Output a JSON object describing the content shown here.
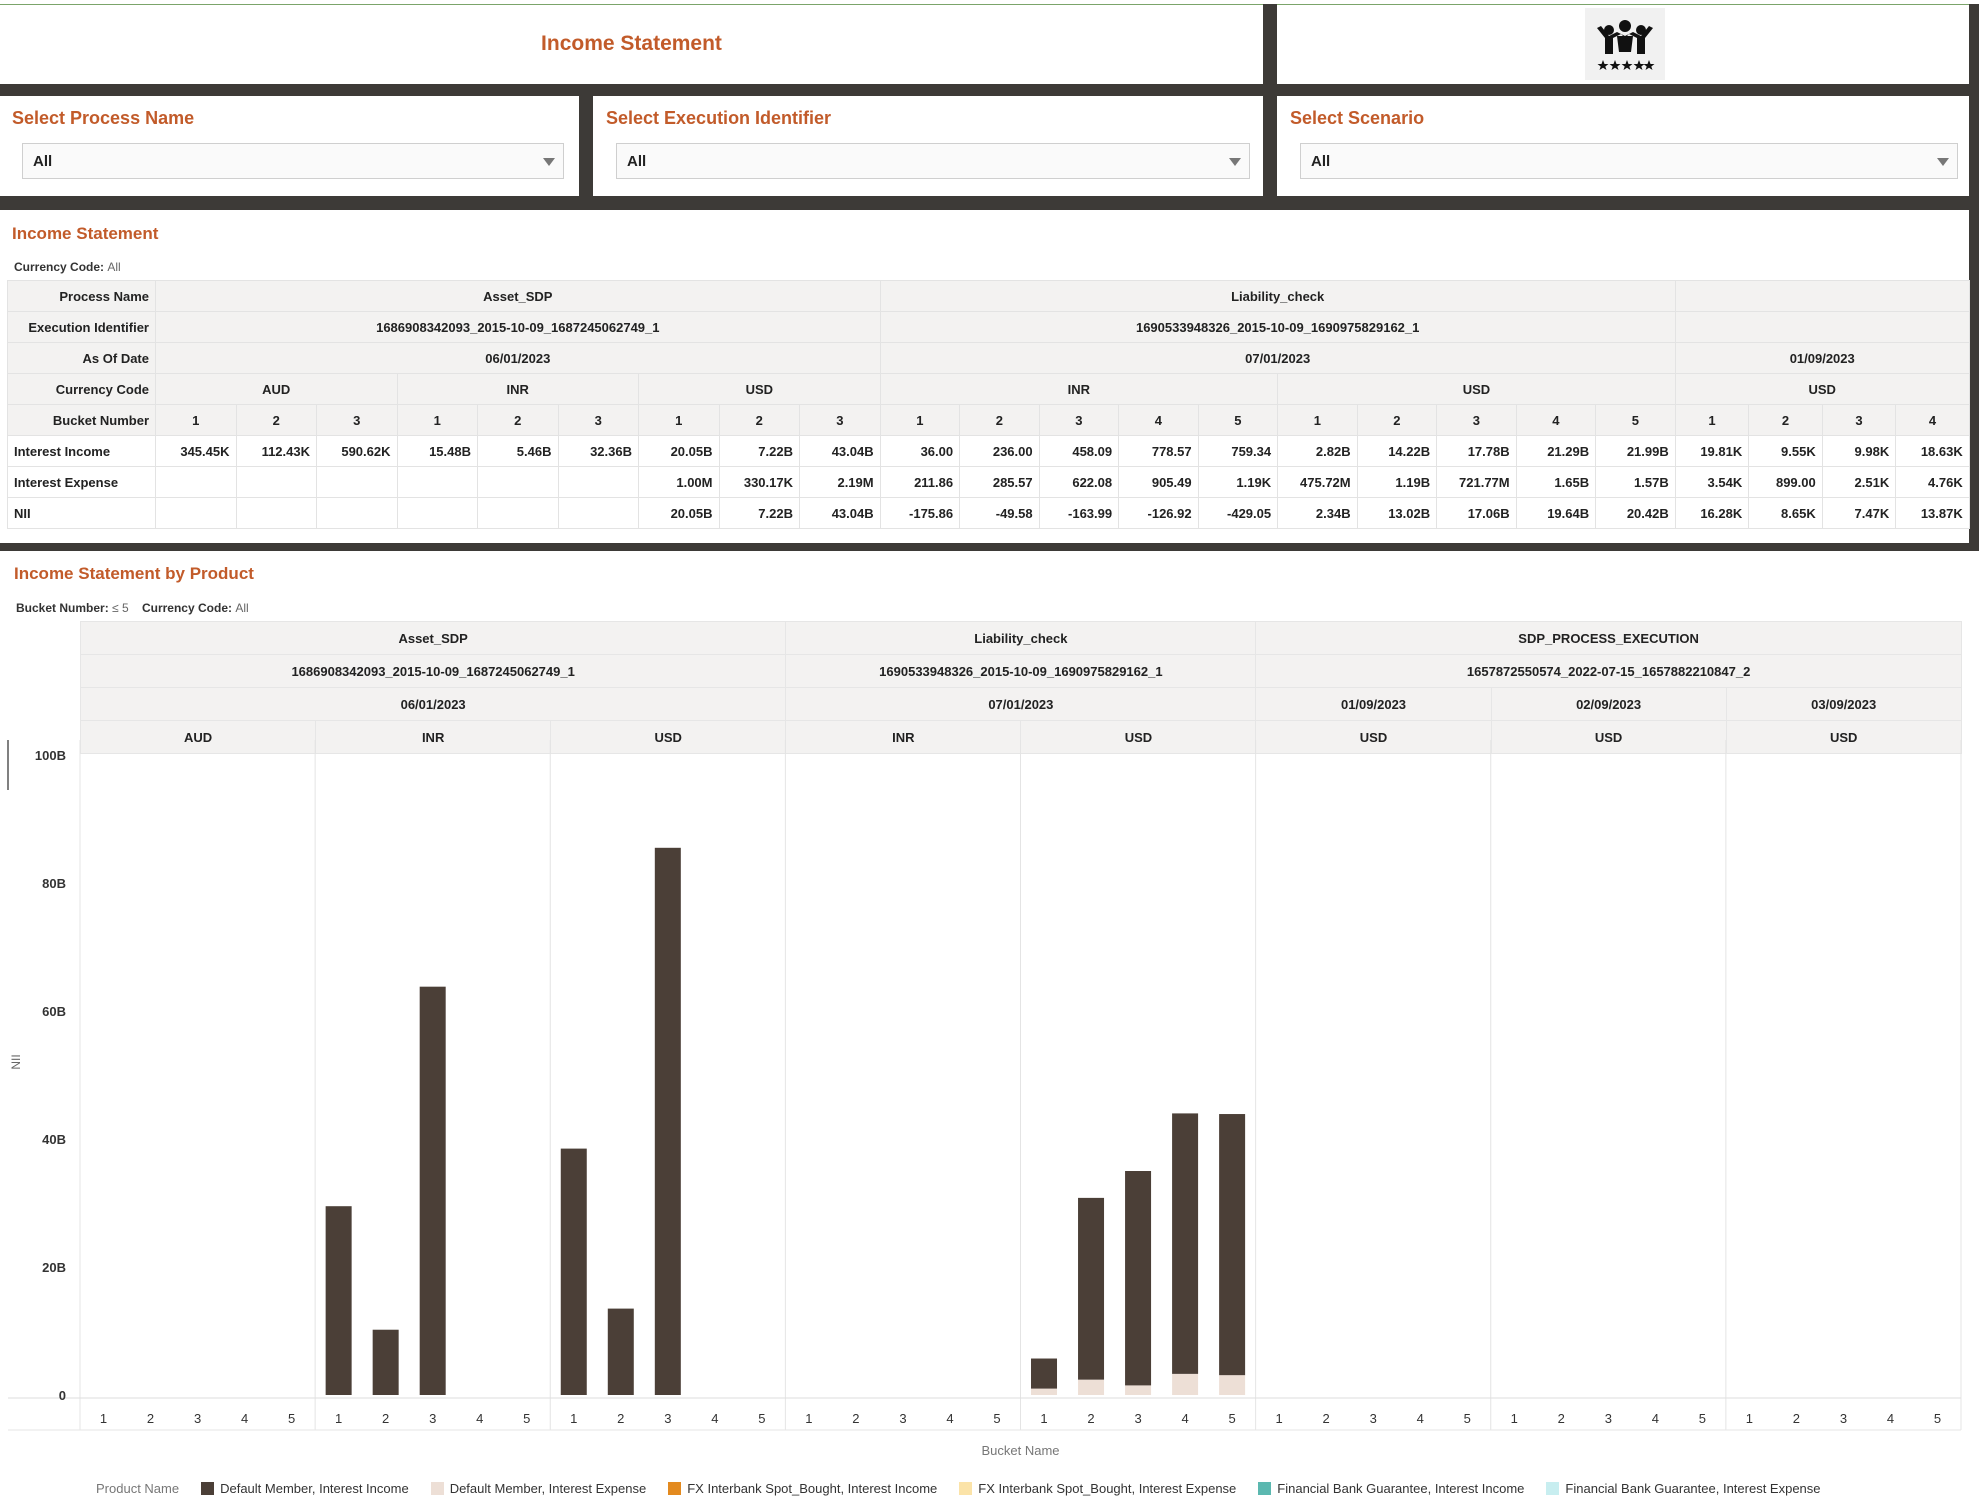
{
  "header": {
    "title": "Income Statement",
    "logo_icon": "people-stars-icon"
  },
  "filters": [
    {
      "label": "Select Process Name",
      "value": "All"
    },
    {
      "label": "Select Execution Identifier",
      "value": "All"
    },
    {
      "label": "Select Scenario",
      "value": "All"
    }
  ],
  "income_statement": {
    "title": "Income Statement",
    "currency_label": "Currency Code:",
    "currency_value": "All",
    "row_labels": {
      "process": "Process Name",
      "execution": "Execution Identifier",
      "as_of": "As Of Date",
      "currency": "Currency Code",
      "bucket": "Bucket Number",
      "income": "Interest Income",
      "expense": "Interest Expense",
      "nii": "NII"
    },
    "processes": [
      "Asset_SDP",
      "Liability_check",
      ""
    ],
    "executions": [
      "1686908342093_2015-10-09_1687245062749_1",
      "1690533948326_2015-10-09_1690975829162_1",
      ""
    ],
    "dates": [
      "06/01/2023",
      "07/01/2023",
      "01/09/2023"
    ],
    "currencies": [
      "AUD",
      "INR",
      "USD",
      "INR",
      "USD",
      "USD"
    ],
    "buckets": [
      "1",
      "2",
      "3",
      "1",
      "2",
      "3",
      "1",
      "2",
      "3",
      "1",
      "2",
      "3",
      "4",
      "5",
      "1",
      "2",
      "3",
      "4",
      "5",
      "1",
      "2",
      "3",
      "4"
    ],
    "interest_income": [
      "345.45K",
      "112.43K",
      "590.62K",
      "15.48B",
      "5.46B",
      "32.36B",
      "20.05B",
      "7.22B",
      "43.04B",
      "36.00",
      "236.00",
      "458.09",
      "778.57",
      "759.34",
      "2.82B",
      "14.22B",
      "17.78B",
      "21.29B",
      "21.99B",
      "19.81K",
      "9.55K",
      "9.98K",
      "18.63K"
    ],
    "interest_expense": [
      "",
      "",
      "",
      "",
      "",
      "",
      "1.00M",
      "330.17K",
      "2.19M",
      "211.86",
      "285.57",
      "622.08",
      "905.49",
      "1.19K",
      "475.72M",
      "1.19B",
      "721.77M",
      "1.65B",
      "1.57B",
      "3.54K",
      "899.00",
      "2.51K",
      "4.76K"
    ],
    "nii": [
      "",
      "",
      "",
      "",
      "",
      "",
      "20.05B",
      "7.22B",
      "43.04B",
      "-175.86",
      "-49.58",
      "-163.99",
      "-126.92",
      "-429.05",
      "2.34B",
      "13.02B",
      "17.06B",
      "19.64B",
      "20.42B",
      "16.28K",
      "8.65K",
      "7.47K",
      "13.87K"
    ]
  },
  "by_product": {
    "title": "Income Statement by Product",
    "bucket_filter_label": "Bucket Number:",
    "bucket_filter_value": "≤ 5",
    "currency_label": "Currency Code:",
    "currency_value": "All",
    "processes": [
      "Asset_SDP",
      "Liability_check",
      "SDP_PROCESS_EXECUTION"
    ],
    "executions": [
      "1686908342093_2015-10-09_1687245062749_1",
      "1690533948326_2015-10-09_1690975829162_1",
      "1657872550574_2022-07-15_1657882210847_2"
    ],
    "dates": [
      "06/01/2023",
      "07/01/2023",
      "01/09/2023",
      "02/09/2023",
      "03/09/2023"
    ],
    "currencies": [
      "AUD",
      "INR",
      "USD",
      "INR",
      "USD",
      "USD",
      "USD",
      "USD"
    ]
  },
  "chart_data": {
    "type": "bar",
    "stacked": true,
    "ylabel": "NII",
    "xlabel": "Bucket Name",
    "ylim": [
      0,
      100
    ],
    "y_unit": "B",
    "yticks": [
      "0",
      "20B",
      "40B",
      "60B",
      "80B",
      "100B"
    ],
    "panels": [
      "AUD",
      "INR",
      "USD",
      "INR",
      "USD",
      "USD",
      "USD",
      "USD"
    ],
    "categories": [
      "1",
      "2",
      "3",
      "4",
      "5"
    ],
    "series": [
      {
        "name": "Default Member, Interest Income",
        "color": "#4b3f37",
        "values": [
          [
            0,
            0,
            0,
            0,
            0
          ],
          [
            29.5,
            10.2,
            63.8,
            0,
            0
          ],
          [
            38.5,
            13.5,
            85.5,
            0,
            0
          ],
          [
            0,
            0,
            0,
            0,
            0
          ],
          [
            4.7,
            28.4,
            33.5,
            40.7,
            40.8
          ],
          [
            0,
            0,
            0,
            0,
            0
          ],
          [
            0,
            0,
            0,
            0,
            0
          ],
          [
            0,
            0,
            0,
            0,
            0
          ]
        ]
      },
      {
        "name": "Default Member, Interest Expense",
        "color": "#eddfd6",
        "values": [
          [
            0,
            0,
            0,
            0,
            0
          ],
          [
            0,
            0,
            0,
            0,
            0
          ],
          [
            0,
            0,
            0,
            0,
            0
          ],
          [
            0,
            0,
            0,
            0,
            0
          ],
          [
            1.0,
            2.4,
            1.5,
            3.3,
            3.1
          ],
          [
            0,
            0,
            0,
            0,
            0
          ],
          [
            0,
            0,
            0,
            0,
            0
          ],
          [
            0,
            0,
            0,
            0,
            0
          ]
        ]
      },
      {
        "name": "FX Interbank Spot_Bought, Interest Income",
        "color": "#e38a1f",
        "values": []
      },
      {
        "name": "FX Interbank Spot_Bought, Interest Expense",
        "color": "#fbe3a8",
        "values": []
      },
      {
        "name": "Financial Bank Guarantee, Interest Income",
        "color": "#5bb8b0",
        "values": []
      },
      {
        "name": "Financial Bank Guarantee, Interest Expense",
        "color": "#c8eef0",
        "values": []
      }
    ],
    "legend_title": "Product Name",
    "legend_position": "bottom"
  }
}
